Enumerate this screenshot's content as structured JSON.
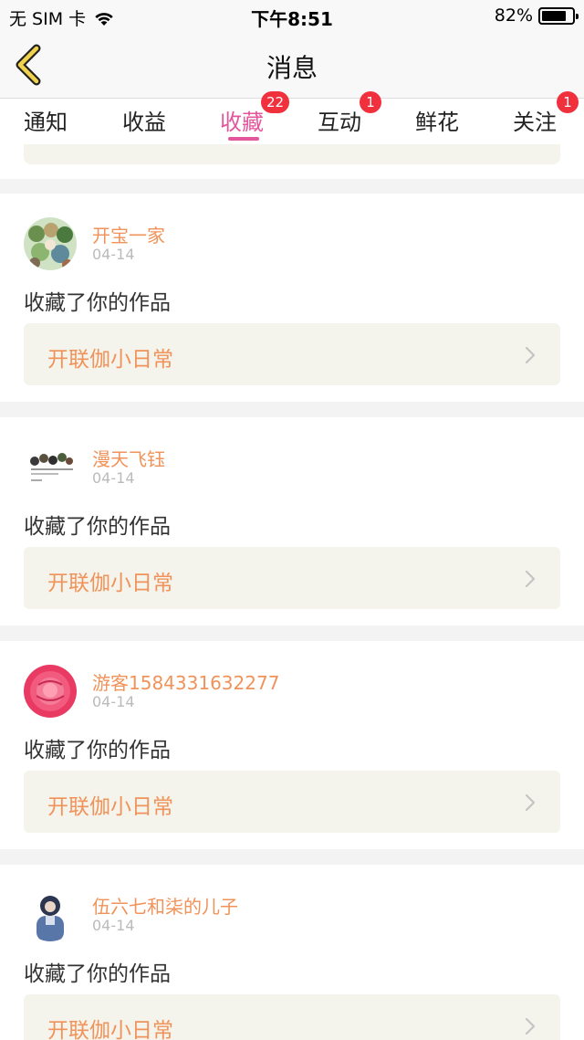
{
  "status_bar": {
    "carrier": "无 SIM 卡",
    "time": "下午8:51",
    "battery": "82%",
    "battery_level": 0.82
  },
  "nav": {
    "title": "消息"
  },
  "tabs": [
    {
      "label": "通知",
      "badge": ""
    },
    {
      "label": "收益",
      "badge": ""
    },
    {
      "label": "收藏",
      "badge": "22",
      "active": true
    },
    {
      "label": "互动",
      "badge": "1"
    },
    {
      "label": "鲜花",
      "badge": ""
    },
    {
      "label": "关注",
      "badge": "1"
    }
  ],
  "notifications": [
    {
      "user": "开宝一家",
      "date": "04-14",
      "action": "收藏了你的作品",
      "work": "开联伽小日常"
    },
    {
      "user": "漫天飞钰",
      "date": "04-14",
      "action": "收藏了你的作品",
      "work": "开联伽小日常"
    },
    {
      "user": "游客1584331632277",
      "date": "04-14",
      "action": "收藏了你的作品",
      "work": "开联伽小日常"
    },
    {
      "user": "伍六七和柒的儿子",
      "date": "04-14",
      "action": "收藏了你的作品",
      "work": "开联伽小日常"
    }
  ],
  "colors": {
    "accent": "#e4569b",
    "name": "#f0935a",
    "badge": "#f0303d"
  }
}
